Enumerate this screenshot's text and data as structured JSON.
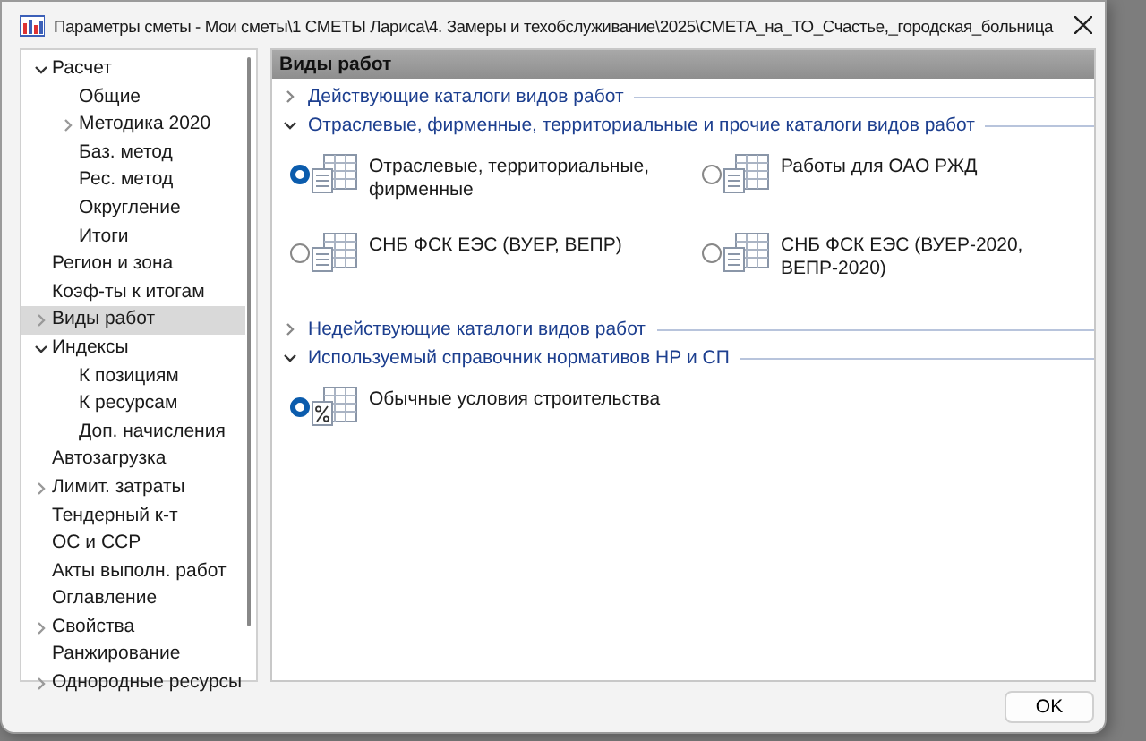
{
  "window": {
    "title": "Параметры сметы - Мои сметы\\1 СМЕТЫ Лариса\\4. Замеры и техобслуживание\\2025\\СМЕТА_на_ТО_Счастье,_городская_больница"
  },
  "sidebar": {
    "items": [
      {
        "label": "Расчет",
        "expanded": true,
        "selected": false,
        "children": [
          {
            "label": "Общие",
            "selected": false
          },
          {
            "label": "Методика 2020",
            "expanded": false,
            "selected": false
          },
          {
            "label": "Баз. метод",
            "selected": false
          },
          {
            "label": "Рес. метод",
            "selected": false
          },
          {
            "label": "Округление",
            "selected": false
          },
          {
            "label": "Итоги",
            "selected": false
          }
        ]
      },
      {
        "label": "Регион и зона",
        "selected": false
      },
      {
        "label": "Коэф-ты к итогам",
        "selected": false
      },
      {
        "label": "Виды работ",
        "expanded": false,
        "selected": true
      },
      {
        "label": "Индексы",
        "expanded": true,
        "selected": false,
        "children": [
          {
            "label": "К позициям",
            "selected": false
          },
          {
            "label": "К ресурсам",
            "selected": false
          },
          {
            "label": "Доп. начисления",
            "selected": false
          }
        ]
      },
      {
        "label": "Автозагрузка",
        "selected": false
      },
      {
        "label": "Лимит. затраты",
        "expanded": false,
        "selected": false
      },
      {
        "label": "Тендерный к-т",
        "selected": false
      },
      {
        "label": "ОС и ССР",
        "selected": false
      },
      {
        "label": "Акты выполн. работ",
        "selected": false
      },
      {
        "label": "Оглавление",
        "selected": false
      },
      {
        "label": "Свойства",
        "expanded": false,
        "selected": false
      },
      {
        "label": "Ранжирование",
        "selected": false
      },
      {
        "label": "Однородные ресурсы",
        "expanded": false,
        "selected": false
      }
    ]
  },
  "panel": {
    "title": "Виды работ",
    "groups": [
      {
        "title": "Действующие каталоги видов работ",
        "expanded": false
      },
      {
        "title": "Отраслевые, фирменные, территориальные и прочие каталоги видов работ",
        "expanded": true,
        "options": [
          {
            "label": "Отраслевые, территориальные, фирменные",
            "selected": true,
            "kind": "catalog"
          },
          {
            "label": "Работы для ОАО РЖД",
            "selected": false,
            "kind": "catalog"
          },
          {
            "label": "СНБ ФСК ЕЭС (ВУЕР, ВЕПР)",
            "selected": false,
            "kind": "catalog"
          },
          {
            "label": "СНБ ФСК ЕЭС (ВУЕР-2020, ВЕПР-2020)",
            "selected": false,
            "kind": "catalog"
          }
        ]
      },
      {
        "title": "Недействующие каталоги видов работ",
        "expanded": false
      },
      {
        "title": "Используемый справочник нормативов НР и СП",
        "expanded": true,
        "options": [
          {
            "label": "Обычные условия строительства",
            "selected": true,
            "kind": "percent"
          }
        ]
      }
    ]
  },
  "buttons": [
    {
      "label": "OK"
    }
  ]
}
